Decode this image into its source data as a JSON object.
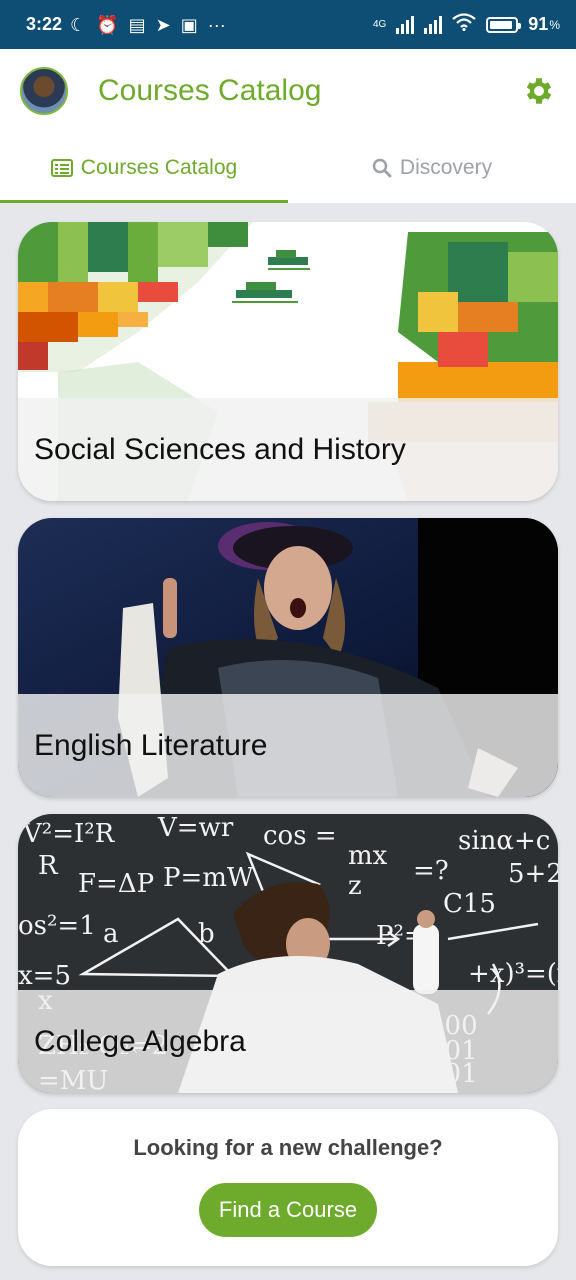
{
  "status": {
    "time": "3:22",
    "battery": "91",
    "battery_level": 0.91,
    "net": "4G",
    "icons_left": [
      "moon-icon",
      "alarm-icon",
      "news-icon",
      "telegram-icon",
      "card-icon",
      "more-icon"
    ]
  },
  "header": {
    "title": "Courses Catalog"
  },
  "tabs": [
    {
      "label": "Courses Catalog",
      "active": true
    },
    {
      "label": "Discovery",
      "active": false
    }
  ],
  "cards": [
    {
      "label": "Social Sciences and History"
    },
    {
      "label": "English Literature"
    },
    {
      "label": "College Algebra"
    }
  ],
  "cta": {
    "question": "Looking for a new challenge?",
    "button": "Find a Course"
  },
  "colors": {
    "accent": "#6eab2c",
    "statusbar": "#0e4d74"
  }
}
